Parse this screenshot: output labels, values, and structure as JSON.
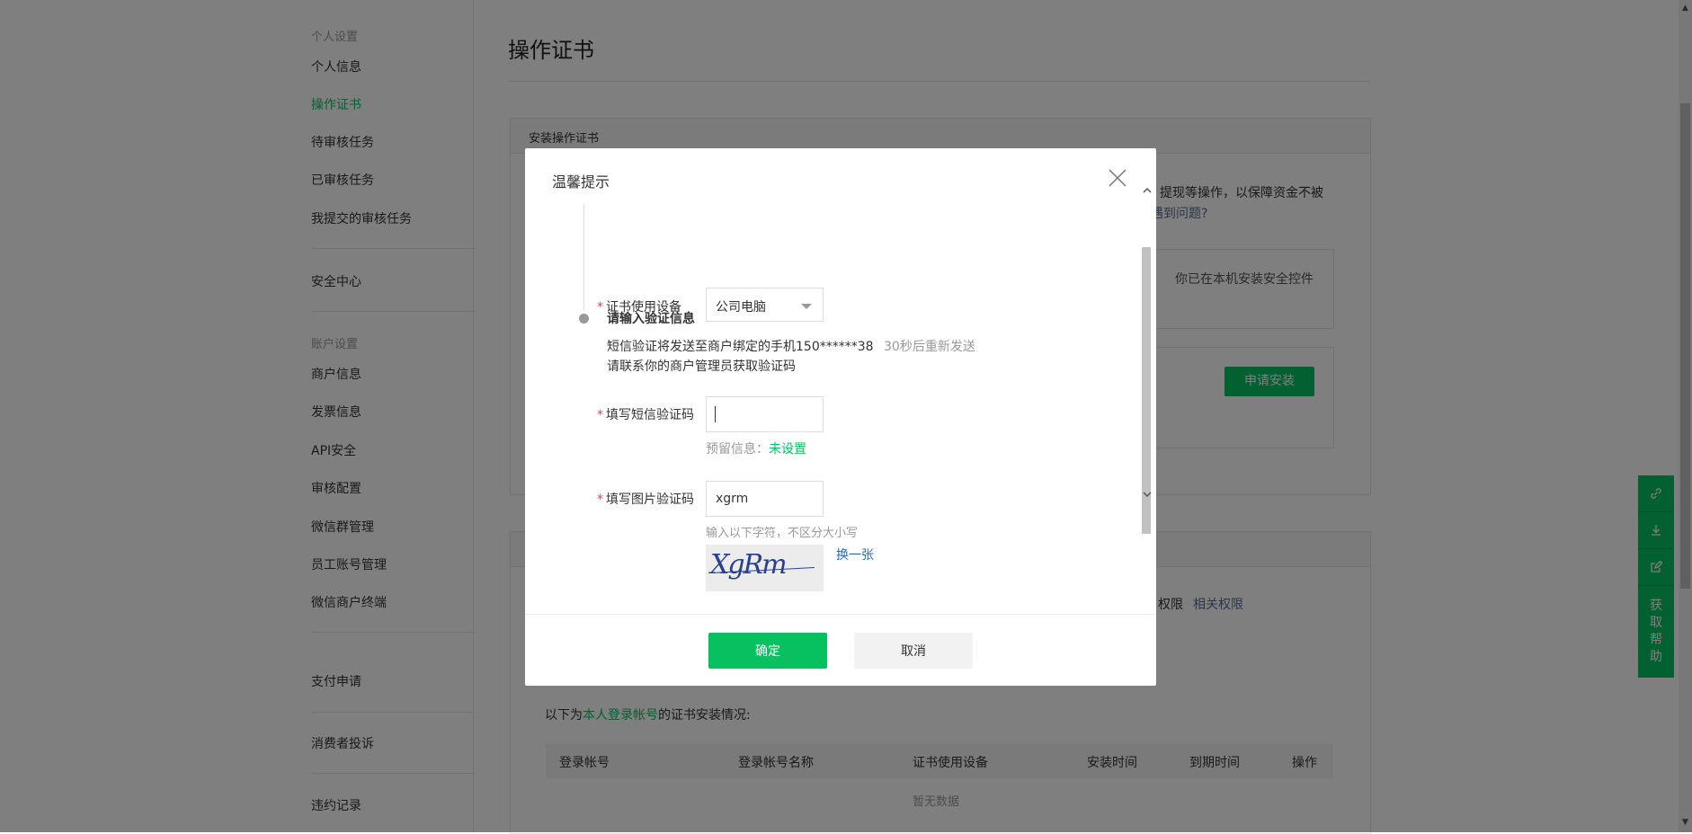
{
  "sidebar": {
    "group_personal": "个人设置",
    "items_personal": [
      "个人信息",
      "操作证书",
      "待审核任务",
      "已审核任务",
      "我提交的审核任务"
    ],
    "security_center": "安全中心",
    "group_account": "账户设置",
    "items_account": [
      "商户信息",
      "发票信息",
      "API安全",
      "审核配置",
      "微信群管理",
      "员工账号管理",
      "微信商户终端"
    ],
    "pay_apply": "支付申请",
    "consumer_complaint": "消费者投诉",
    "violation_record": "违约记录"
  },
  "main": {
    "title": "操作证书",
    "install_panel_title": "安装操作证书",
    "notice_fragment": "提现等操作，以保障资金不被",
    "problem_link": "遇到问题?",
    "installed_notice": "你已在本机安装安全控件",
    "apply_install_button": "申请安装",
    "permission_text": "权限",
    "related_permission_link": "相关权限",
    "install_status_prefix": "以下为",
    "install_status_link": "本人登录帐号",
    "install_status_suffix": "的证书安装情况:",
    "table_headers": [
      "登录帐号",
      "登录帐号名称",
      "证书使用设备",
      "安装时间",
      "到期时间",
      "操作"
    ],
    "empty_text": "暂无数据"
  },
  "right_tools": {
    "icons": [
      "link-icon",
      "download-icon",
      "edit-icon"
    ],
    "help_chars": [
      "获",
      "取",
      "帮",
      "助"
    ]
  },
  "dialog": {
    "title": "温馨提示",
    "device_label": "证书使用设备",
    "device_value": "公司电脑",
    "step_title": "请输入验证信息",
    "sms_hint": "短信验证将发送至商户绑定的手机150******38",
    "resend_text": "30秒后重新发送",
    "contact_hint": "请联系你的商户管理员获取验证码",
    "sms_label": "填写短信验证码",
    "sms_value": "",
    "reserved_label": "预留信息：",
    "reserved_value": "未设置",
    "image_code_label": "填写图片验证码",
    "image_code_value": "xgrm",
    "image_code_hint": "输入以下字符，不区分大小写",
    "captcha_text": "XgRm",
    "refresh_label": "换一张",
    "ok_button": "确定",
    "cancel_button": "取消"
  },
  "colors": {
    "brand_green": "#07c160",
    "link_blue": "#576b95",
    "required_red": "#e64340"
  }
}
